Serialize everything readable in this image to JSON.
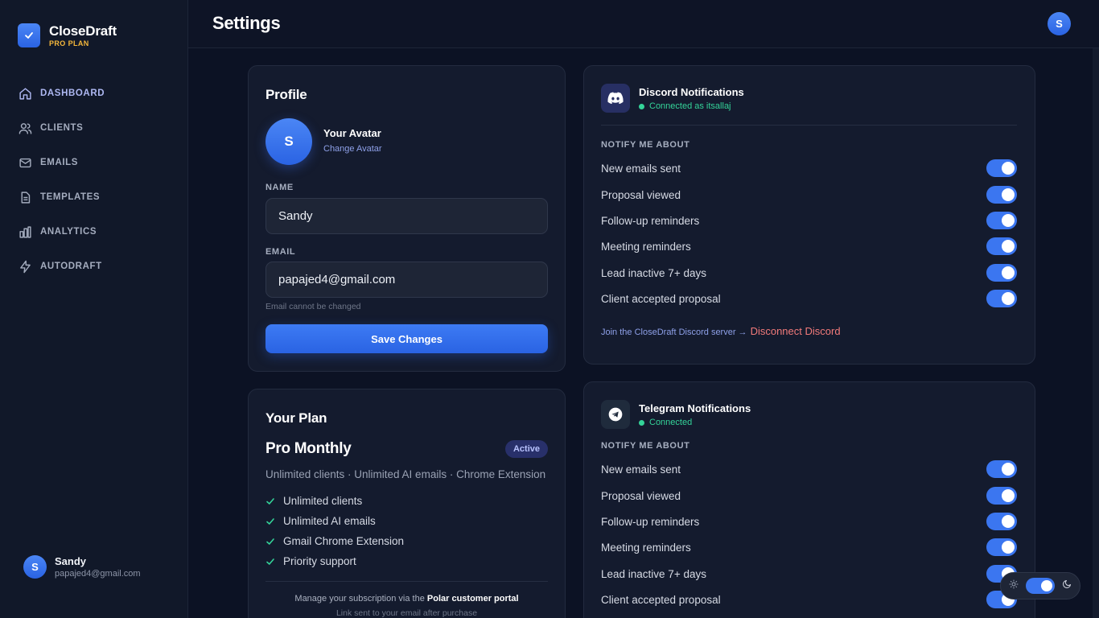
{
  "brand": {
    "name": "CloseDraft",
    "plan": "PRO PLAN"
  },
  "nav": [
    {
      "label": "DASHBOARD",
      "icon": "home-icon",
      "active": true
    },
    {
      "label": "CLIENTS",
      "icon": "users-icon",
      "active": false
    },
    {
      "label": "EMAILS",
      "icon": "mail-icon",
      "active": false
    },
    {
      "label": "TEMPLATES",
      "icon": "document-icon",
      "active": false
    },
    {
      "label": "ANALYTICS",
      "icon": "bar-chart-icon",
      "active": false
    },
    {
      "label": "AUTODRAFT",
      "icon": "lightning-icon",
      "active": false
    }
  ],
  "user": {
    "initial": "S",
    "name": "Sandy",
    "email": "papajed4@gmail.com"
  },
  "header": {
    "title": "Settings",
    "avatar_initial": "S"
  },
  "profile": {
    "title": "Profile",
    "avatar_initial": "S",
    "avatar_label": "Your Avatar",
    "change_avatar": "Change Avatar",
    "name_label": "NAME",
    "name_value": "Sandy",
    "email_label": "EMAIL",
    "email_value": "papajed4@gmail.com",
    "email_hint": "Email cannot be changed",
    "save_label": "Save Changes"
  },
  "plan": {
    "title": "Your Plan",
    "name": "Pro Monthly",
    "status": "Active",
    "summary": "Unlimited clients · Unlimited AI emails · Chrome Extension",
    "features": [
      "Unlimited clients",
      "Unlimited AI emails",
      "Gmail Chrome Extension",
      "Priority support"
    ],
    "manage_prefix": "Manage your subscription via the ",
    "manage_link": "Polar customer portal",
    "manage_note": "Link sent to your email after purchase"
  },
  "discord": {
    "title": "Discord Notifications",
    "status": "Connected as itsallaj",
    "notify_label": "NOTIFY ME ABOUT",
    "prefs": [
      {
        "label": "New emails sent",
        "on": true
      },
      {
        "label": "Proposal viewed",
        "on": true
      },
      {
        "label": "Follow-up reminders",
        "on": true
      },
      {
        "label": "Meeting reminders",
        "on": true
      },
      {
        "label": "Lead inactive 7+ days",
        "on": true
      },
      {
        "label": "Client accepted proposal",
        "on": true
      }
    ],
    "join_link": "Join the CloseDraft Discord server →",
    "disconnect": "Disconnect Discord"
  },
  "telegram": {
    "title": "Telegram Notifications",
    "status": "Connected",
    "notify_label": "NOTIFY ME ABOUT",
    "prefs": [
      {
        "label": "New emails sent",
        "on": true
      },
      {
        "label": "Proposal viewed",
        "on": true
      },
      {
        "label": "Follow-up reminders",
        "on": true
      },
      {
        "label": "Meeting reminders",
        "on": true
      },
      {
        "label": "Lead inactive 7+ days",
        "on": true
      },
      {
        "label": "Client accepted proposal",
        "on": true
      }
    ]
  },
  "theme": {
    "mode": "dark",
    "icons": [
      "sun-icon",
      "moon-icon"
    ]
  },
  "colors": {
    "accent": "#3b76f0",
    "background": "#0c1224",
    "card": "#141b2e",
    "success": "#34d399",
    "danger": "#f17a7a",
    "plan_badge": "#f5b73b"
  }
}
